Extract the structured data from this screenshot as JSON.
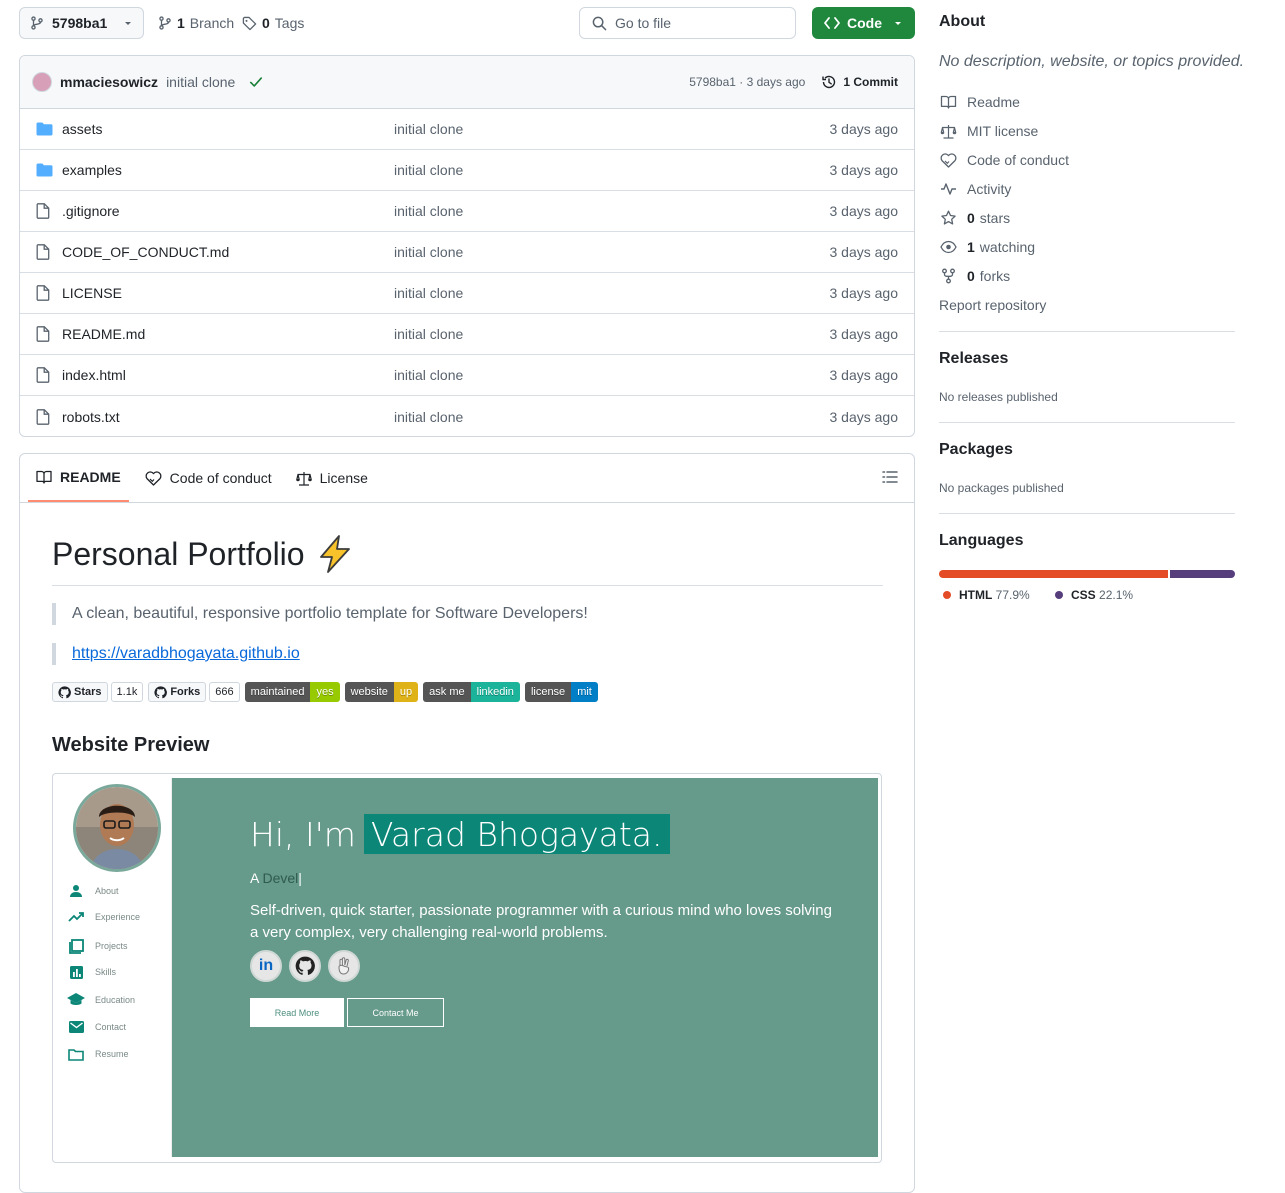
{
  "toolbar": {
    "branch_name": "5798ba1",
    "branches_count": "1",
    "branches_label": "Branch",
    "tags_count": "0",
    "tags_label": "Tags",
    "goto_placeholder": "Go to file",
    "code_label": "Code"
  },
  "commit": {
    "author": "mmaciesowicz",
    "message": "initial clone",
    "meta": "5798ba1 · 3 days ago",
    "count_label": "1 Commit"
  },
  "files": [
    {
      "name": "assets",
      "type": "folder",
      "message": "initial clone",
      "date": "3 days ago"
    },
    {
      "name": "examples",
      "type": "folder",
      "message": "initial clone",
      "date": "3 days ago"
    },
    {
      "name": ".gitignore",
      "type": "file",
      "message": "initial clone",
      "date": "3 days ago"
    },
    {
      "name": "CODE_OF_CONDUCT.md",
      "type": "file",
      "message": "initial clone",
      "date": "3 days ago"
    },
    {
      "name": "LICENSE",
      "type": "file",
      "message": "initial clone",
      "date": "3 days ago"
    },
    {
      "name": "README.md",
      "type": "file",
      "message": "initial clone",
      "date": "3 days ago"
    },
    {
      "name": "index.html",
      "type": "file",
      "message": "initial clone",
      "date": "3 days ago"
    },
    {
      "name": "robots.txt",
      "type": "file",
      "message": "initial clone",
      "date": "3 days ago"
    }
  ],
  "readme_tabs": [
    "README",
    "Code of conduct",
    "License"
  ],
  "readme": {
    "title": "Personal Portfolio",
    "title_emoji": "lightning-icon",
    "quote": "A clean, beautiful, responsive portfolio template for Software Developers!",
    "link": "https://varadbhogayata.github.io",
    "github_badges": [
      {
        "label": "Stars",
        "count": "1.1k"
      },
      {
        "label": "Forks",
        "count": "666"
      }
    ],
    "shield_badges": [
      {
        "left": "maintained",
        "right": "yes",
        "color": "#97ca00"
      },
      {
        "left": "website",
        "right": "up",
        "color": "#dfb317"
      },
      {
        "left": "ask me",
        "right": "linkedin",
        "color": "#1bb39a"
      },
      {
        "left": "license",
        "right": "mit",
        "color": "#007ec6"
      }
    ],
    "preview_heading": "Website Preview"
  },
  "preview": {
    "nav": [
      "About",
      "Experience",
      "Projects",
      "Skills",
      "Education",
      "Contact",
      "Resume"
    ],
    "greeting": "Hi, I'm",
    "name": "Varad Bhogayata.",
    "role_prefix": "A",
    "role_typed": "Devel",
    "description": "Self-driven, quick starter, passionate programmer with a curious mind who loves solving a very complex, very challenging real-world problems.",
    "read_more": "Read More",
    "contact_me": "Contact Me",
    "colors": {
      "bg": "#669a8a",
      "accent": "#0b8677"
    }
  },
  "sidebar": {
    "about_heading": "About",
    "description": "No description, website, or topics provided.",
    "links": [
      {
        "icon": "book-icon",
        "text": "Readme",
        "bold": ""
      },
      {
        "icon": "scale-icon",
        "text": "MIT license",
        "bold": ""
      },
      {
        "icon": "code-of-conduct-icon",
        "text": "Code of conduct",
        "bold": ""
      },
      {
        "icon": "pulse-icon",
        "text": "Activity",
        "bold": ""
      },
      {
        "icon": "star-icon",
        "text": "stars",
        "bold": "0"
      },
      {
        "icon": "eye-icon",
        "text": "watching",
        "bold": "1"
      },
      {
        "icon": "fork-icon",
        "text": "forks",
        "bold": "0"
      }
    ],
    "report": "Report repository",
    "releases_heading": "Releases",
    "releases_text": "No releases published",
    "packages_heading": "Packages",
    "packages_text": "No packages published",
    "languages_heading": "Languages",
    "languages": [
      {
        "name": "HTML",
        "percent": "77.9%",
        "value": 77.9,
        "color": "#e34c26"
      },
      {
        "name": "CSS",
        "percent": "22.1%",
        "value": 22.1,
        "color": "#563d7c"
      }
    ]
  }
}
